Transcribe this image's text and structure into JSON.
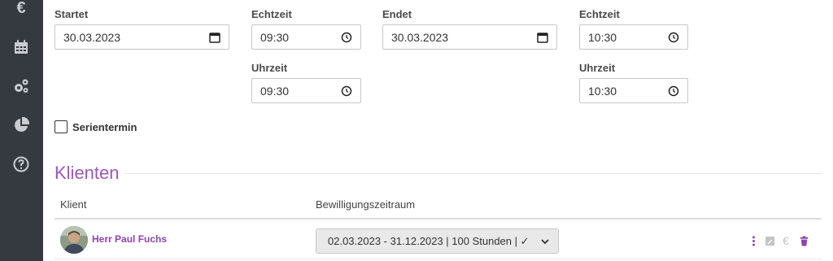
{
  "sidebar": {
    "items": [
      {
        "icon": "euro-icon",
        "glyph": "€"
      },
      {
        "icon": "calendar-icon"
      },
      {
        "icon": "cogs-icon"
      },
      {
        "icon": "pie-chart-icon"
      },
      {
        "icon": "help-icon"
      }
    ]
  },
  "form": {
    "start_label": "Startet",
    "start_date": "30.03.2023",
    "start_realtime_label": "Echtzeit",
    "start_realtime": "09:30",
    "start_time_label": "Uhrzeit",
    "start_time": "09:30",
    "end_label": "Endet",
    "end_date": "30.03.2023",
    "end_realtime_label": "Echtzeit",
    "end_realtime": "10:30",
    "end_time_label": "Uhrzeit",
    "end_time": "10:30",
    "series_label": "Serientermin",
    "series_checked": false
  },
  "clients": {
    "title": "Klienten",
    "headers": {
      "client": "Klient",
      "period": "Bewilligungszeitraum"
    },
    "rows": [
      {
        "name": "Herr Paul Fuchs",
        "period": "02.03.2023 - 31.12.2023 | 100 Stunden | ✓"
      }
    ]
  },
  "colors": {
    "accent": "#9b59b6",
    "sidebar": "#343a40",
    "link": "#8e44ad"
  }
}
